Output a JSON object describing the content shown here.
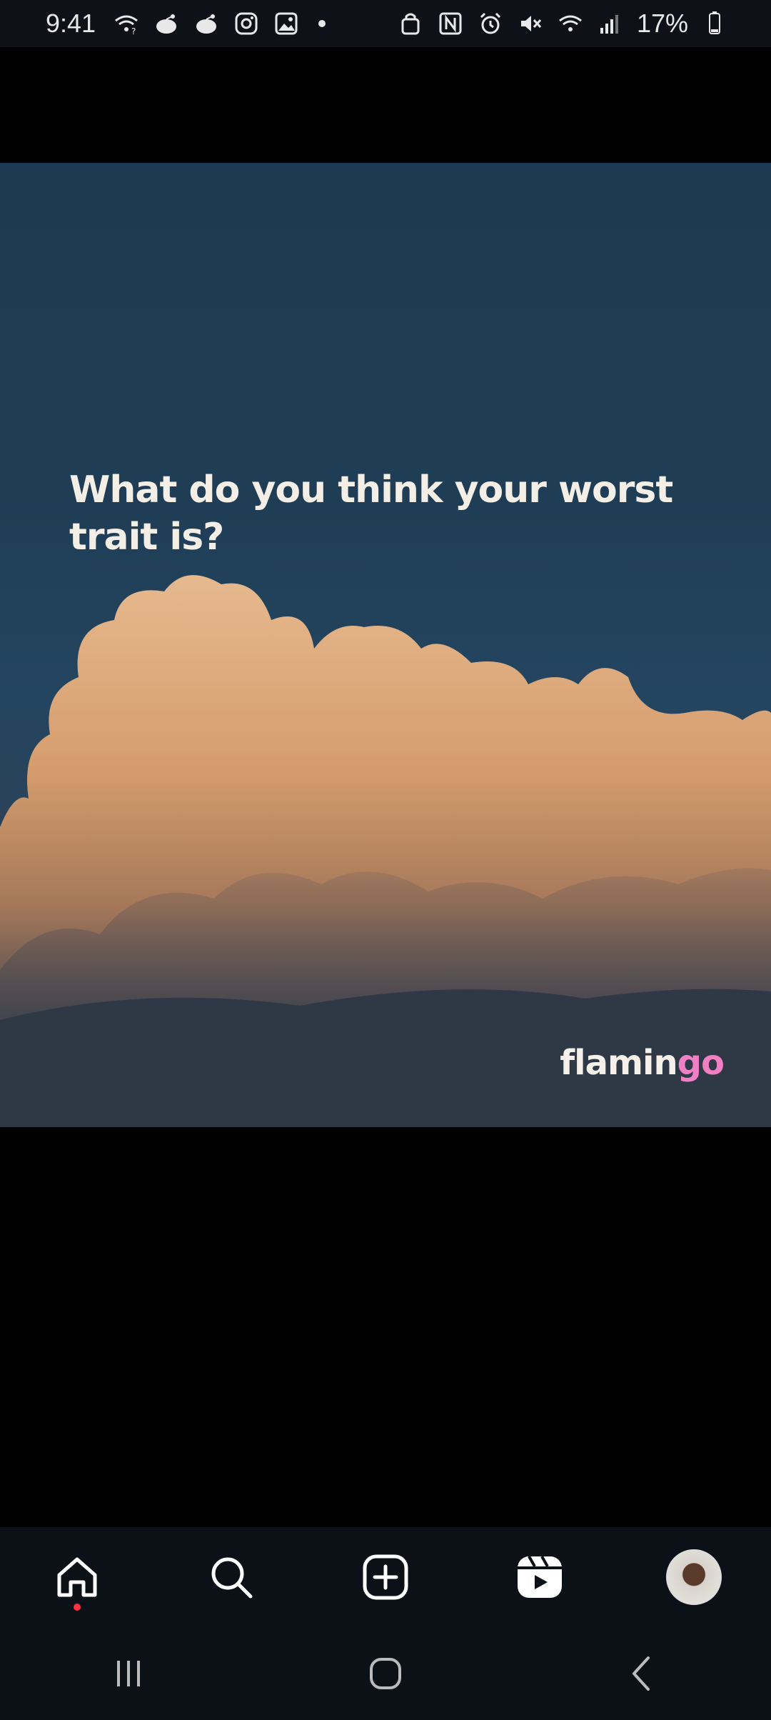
{
  "status_bar": {
    "time": "9:41",
    "battery": "17%",
    "left_icons": [
      "wifi-question-icon",
      "reddit-icon",
      "reddit-icon",
      "instagram-icon",
      "gallery-icon"
    ],
    "right_icons": [
      "nfc-lock-icon",
      "nfc-icon",
      "alarm-icon",
      "mute-icon",
      "wifi-icon",
      "signal-icon",
      "battery-icon"
    ]
  },
  "post": {
    "question": "What do you think your worst trait is?",
    "brand_white": "flamin",
    "brand_pink": "go",
    "brand_color": "#f07fc4"
  },
  "bottom_nav": {
    "items": [
      "home-icon",
      "search-icon",
      "create-icon",
      "reels-icon",
      "profile-avatar"
    ],
    "notification_color": "#ff3040"
  },
  "system_nav": {
    "items": [
      "recents-icon",
      "home-button-icon",
      "back-icon"
    ]
  }
}
